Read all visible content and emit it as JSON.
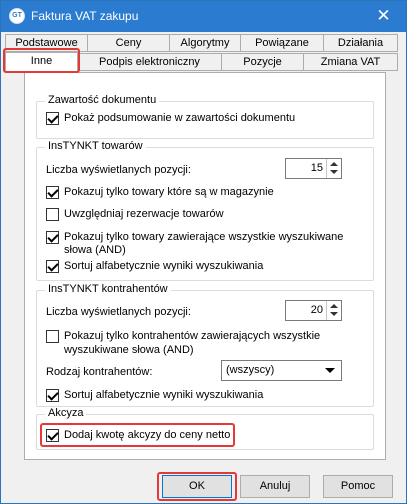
{
  "window": {
    "title": "Faktura VAT zakupu",
    "app_icon_text": "GT",
    "close_label": "✕"
  },
  "tabs_row1": [
    "Podstawowe",
    "Ceny",
    "Algorytmy",
    "Powiązane",
    "Działania"
  ],
  "tabs_row2": [
    "Inne",
    "Podpis elektroniczny",
    "Pozycje",
    "Zmiana VAT"
  ],
  "active_tab": "Inne",
  "groups": {
    "zawartosc": {
      "title": "Zawartość dokumentu",
      "items": [
        {
          "label": "Pokaż podsumowanie w zawartości dokumentu",
          "checked": true
        }
      ]
    },
    "instynkt_towarow": {
      "title": "InsTYNKT towarów",
      "count_label": "Liczba wyświetlanych pozycji:",
      "count_value": "15",
      "items": [
        {
          "label": "Pokazuj tylko towary które są w magazynie",
          "checked": true
        },
        {
          "label": "Uwzględniaj rezerwacje towarów",
          "checked": false
        },
        {
          "label": "Pokazuj tylko towary zawierające wszystkie wyszukiwane",
          "label2": "słowa (AND)",
          "checked": true
        },
        {
          "label": "Sortuj alfabetycznie wyniki wyszukiwania",
          "checked": true
        }
      ]
    },
    "instynkt_kontrahentow": {
      "title": "InsTYNKT kontrahentów",
      "count_label": "Liczba wyświetlanych pozycji:",
      "count_value": "20",
      "items": [
        {
          "label": "Pokazuj tylko kontrahentów zawierających wszystkie",
          "label2": "wyszukiwane słowa (AND)",
          "checked": false
        },
        {
          "label": "Sortuj alfabetycznie wyniki wyszukiwania",
          "checked": true
        }
      ],
      "rodzaj_label": "Rodzaj kontrahentów:",
      "rodzaj_value": "(wszyscy)"
    },
    "akcyza": {
      "title": "Akcyza",
      "items": [
        {
          "label": "Dodaj kwotę akcyzy do ceny netto",
          "checked": true
        }
      ]
    }
  },
  "buttons": {
    "ok": "OK",
    "cancel": "Anuluj",
    "help": "Pomoc"
  },
  "colors": {
    "titlebar": "#2b7bd0",
    "highlight": "#e53935"
  }
}
